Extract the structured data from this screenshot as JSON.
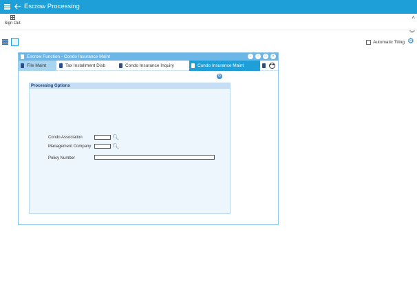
{
  "app": {
    "title": "Escrow Processing"
  },
  "header": {
    "signout_label": "Sign Out"
  },
  "toolbar": {
    "automatic_tiling_label": "Automatic Tiling"
  },
  "window": {
    "title": "Escrow Function - Condo Insurance Maint",
    "tabs": [
      {
        "label": "File Maint"
      },
      {
        "label": "Tax Installment Disb"
      },
      {
        "label": "Condo Insurance Inquiry"
      },
      {
        "label": "Condo Insurance Maint"
      }
    ],
    "more_tabs_label": "•••"
  },
  "panel": {
    "title": "Processing Options",
    "fields": {
      "condo_association": {
        "label": "Condo Association",
        "value": ""
      },
      "management_company": {
        "label": "Management Company",
        "value": ""
      },
      "policy_number": {
        "label": "Policy Number",
        "value": ""
      }
    }
  },
  "colors": {
    "topbar": "#1e9fd8",
    "window_title": "#6db6e8",
    "panel_bg": "#eef6fd",
    "panel_header": "#c7ddf5"
  },
  "icons": [
    "hamburger-icon",
    "back-icon",
    "sign-out-icon",
    "collapse-up-icon",
    "collapse-down-icon",
    "list-icon",
    "document-icon",
    "settings-icon",
    "refresh-icon",
    "lookup-icon"
  ]
}
